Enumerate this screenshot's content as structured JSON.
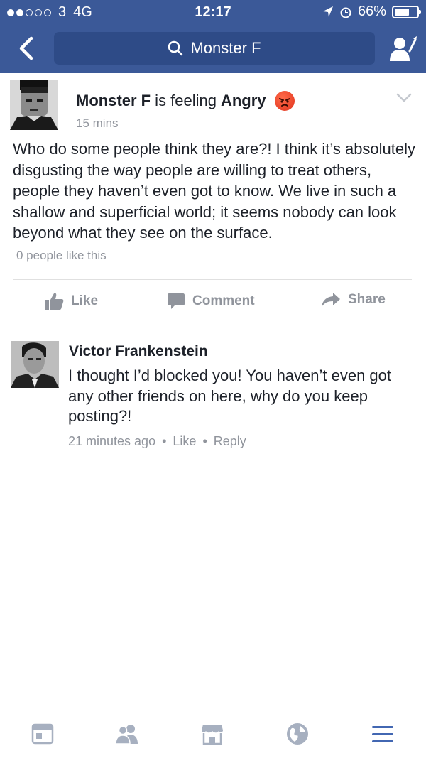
{
  "status_bar": {
    "carrier": "3",
    "network": "4G",
    "time": "12:17",
    "battery": "66%",
    "battery_level": 0.66
  },
  "header": {
    "search_text": "Monster F",
    "icons": [
      "back-arrow-icon",
      "search-icon",
      "friend-requests-icon"
    ]
  },
  "post": {
    "author": "Monster F",
    "is_feeling": "is feeling",
    "feeling": "Angry",
    "time": "15 mins",
    "text": "Who do some people think they are?! I think it’s absolutely disgusting the way people are willing to treat others, people they haven’t even got to know. We live in such a shallow and superficial world; it seems nobody can look beyond what they see on the surface.",
    "likes": "0 people like this",
    "actions": {
      "like": "Like",
      "comment": "Comment",
      "share": "Share"
    }
  },
  "comment": {
    "author": "Victor Frankenstein",
    "text": "I thought I’d blocked you! You haven’t even got any other friends on here, why do you keep posting?!",
    "time": "21 minutes ago",
    "like": "Like",
    "reply": "Reply",
    "sep": "•"
  },
  "tabbar": {
    "tabs": [
      "news-feed-icon",
      "friends-icon",
      "marketplace-icon",
      "notifications-globe-icon",
      "menu-icon"
    ],
    "active_color": "#4267b2",
    "inactive_color": "#a7b0c0"
  },
  "colors": {
    "brand": "#3b5998",
    "search_bg": "#2e4b87",
    "muted": "#90949c",
    "text": "#1d2129"
  }
}
